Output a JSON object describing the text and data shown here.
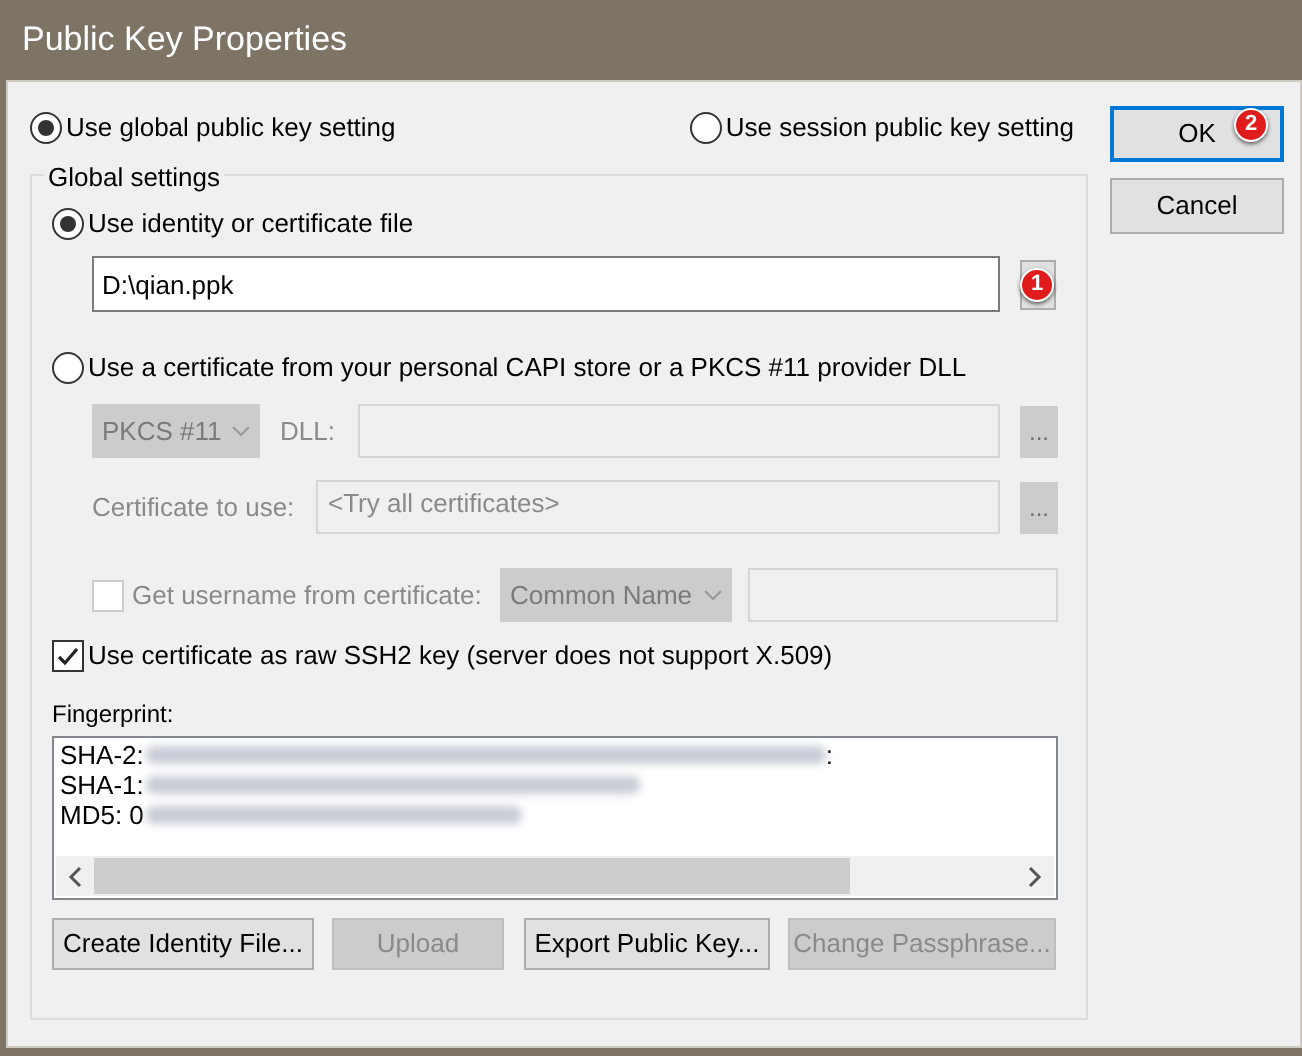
{
  "window": {
    "title": "Public Key Properties"
  },
  "mode_options": [
    {
      "label": "Use global public key setting",
      "selected": true
    },
    {
      "label": "Use session public key setting",
      "selected": false
    }
  ],
  "buttons": [
    {
      "label": "OK",
      "default": true,
      "badge": "2"
    },
    {
      "label": "Cancel",
      "default": false
    }
  ],
  "global_settings": {
    "title": "Global settings",
    "source_options": [
      {
        "label": "Use identity or certificate file",
        "selected": true
      },
      {
        "label": "Use a certificate from your personal CAPI store or a PKCS #11 provider DLL",
        "selected": false
      }
    ],
    "file_path": "D:\\qian.ppk",
    "file_badge": "1",
    "provider": "PKCS #11",
    "dll_label": "DLL:",
    "dll_browse": "...",
    "certificate_label": "Certificate to use:",
    "certificate_value": "<Try all certificates>",
    "certificate_browse": "...",
    "username_check": {
      "label": "Get username from certificate:",
      "checked": false
    },
    "username_source": "Common Name",
    "raw_ssh2": {
      "label": "Use certificate as raw SSH2 key (server does not support X.509)",
      "checked": true
    },
    "fingerprint_label": "Fingerprint:",
    "fingerprint_lines": [
      {
        "text": "SHA-2:",
        "tail": ":"
      },
      {
        "text": "SHA-1:"
      },
      {
        "text": "MD5: 0"
      }
    ],
    "actions": [
      {
        "label": "Create Identity File...",
        "disabled": false
      },
      {
        "label": "Upload",
        "disabled": true
      },
      {
        "label": "Export Public Key...",
        "disabled": false
      },
      {
        "label": "Change Passphrase...",
        "disabled": true
      }
    ]
  }
}
